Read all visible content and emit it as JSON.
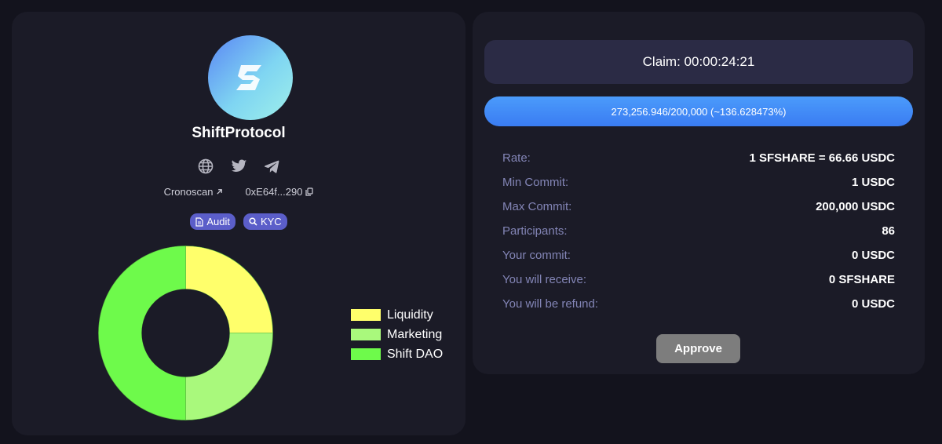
{
  "project": {
    "name": "ShiftProtocol",
    "logo_icon": "shift-logo-icon",
    "socials": [
      {
        "name": "website",
        "icon": "globe-icon"
      },
      {
        "name": "twitter",
        "icon": "twitter-icon"
      },
      {
        "name": "telegram",
        "icon": "telegram-icon"
      }
    ],
    "explorer_label": "Cronoscan",
    "contract_address": "0xE64f...290",
    "badges": {
      "audit": "Audit",
      "kyc": "KYC"
    },
    "badge_color": "#5b5ec9"
  },
  "chart_data": {
    "type": "pie",
    "style": "donut",
    "categories": [
      "Liquidity",
      "Marketing",
      "Shift DAO"
    ],
    "values": [
      25,
      25,
      50
    ],
    "colors": [
      "#ffff6b",
      "#a9f97c",
      "#6efa4b"
    ],
    "legend_position": "right"
  },
  "sale": {
    "claim_text": "Claim: 00:00:24:21",
    "progress_text": "273,256.946/200,000 (~136.628473%)",
    "progress_fraction": 1.0,
    "progress_color": "#3f87f6",
    "details": [
      {
        "label": "Rate:",
        "value": "1 SFSHARE = 66.66 USDC"
      },
      {
        "label": "Min Commit:",
        "value": "1 USDC"
      },
      {
        "label": "Max Commit:",
        "value": "200,000 USDC"
      },
      {
        "label": "Participants:",
        "value": "86"
      },
      {
        "label": "Your commit:",
        "value": "0 USDC"
      },
      {
        "label": "You will receive:",
        "value": "0 SFSHARE"
      },
      {
        "label": "You will be refund:",
        "value": "0 USDC"
      }
    ],
    "approve_label": "Approve"
  }
}
